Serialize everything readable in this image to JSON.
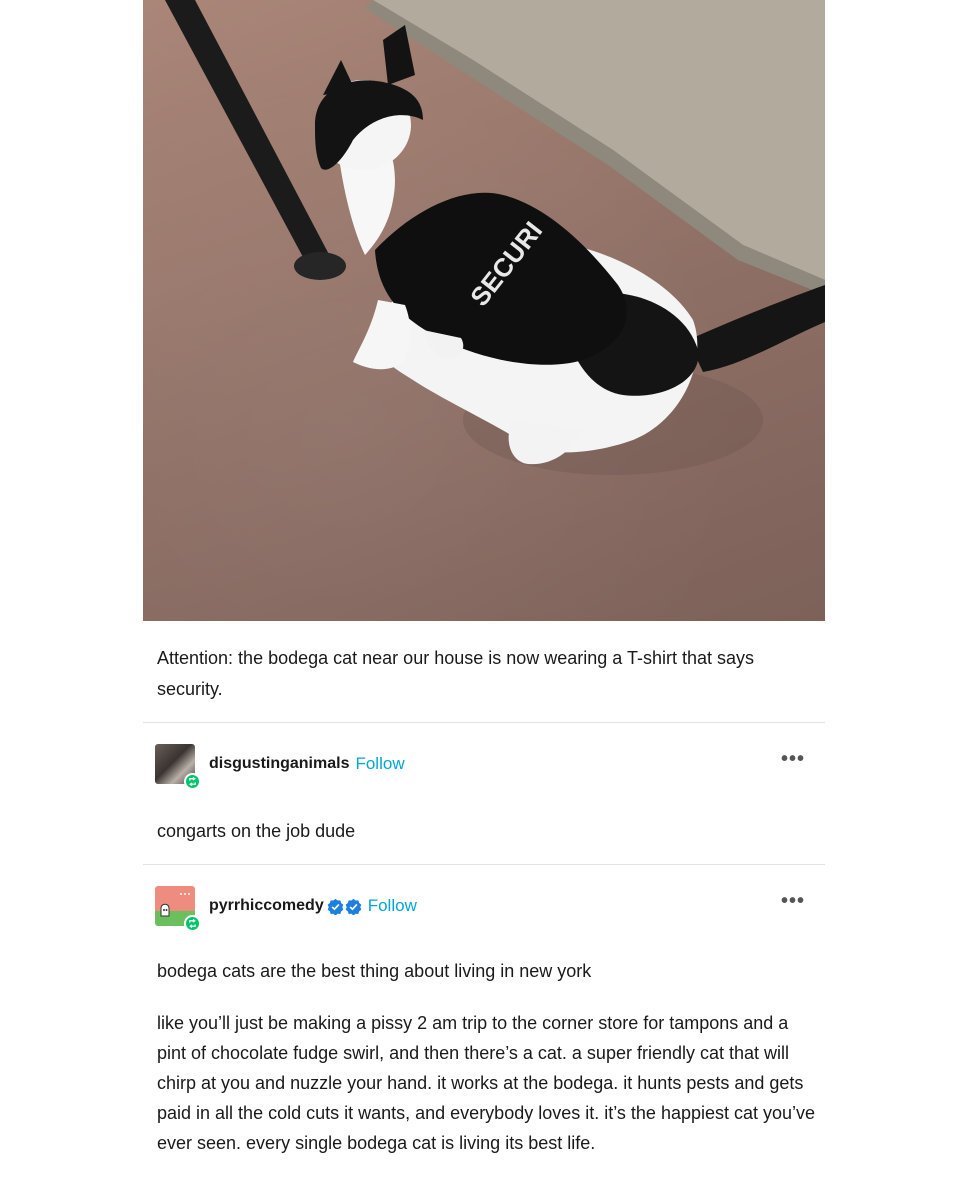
{
  "post": {
    "photo": {
      "shirt_text": "SECURI"
    },
    "caption": "Attention: the bodega cat near our house is now wearing a T-shirt that says security."
  },
  "reblogs": [
    {
      "username": "disgustinganimals",
      "follow_label": "Follow",
      "more_label": "•••",
      "paragraphs": [
        "congarts on the job dude"
      ]
    },
    {
      "username": "pyrrhiccomedy",
      "follow_label": "Follow",
      "more_label": "•••",
      "verified_icons": [
        "verified-badge-icon",
        "verified-badge-icon"
      ],
      "paragraphs": [
        "bodega cats are the best thing about living in new york",
        "like you’ll just be making a pissy 2 am trip to the corner store for tampons and a pint of chocolate fudge swirl, and then there’s a cat. a super friendly cat that will chirp at you and nuzzle your hand. it works at the bodega. it hunts pests and gets paid in all the cold cuts it wants, and everybody loves it. it’s the happiest cat you’ve ever seen. every single bodega cat is living its best life."
      ]
    }
  ],
  "colors": {
    "follow": "#00a7d8",
    "reblog_badge": "#00c46a",
    "verified": "#1d7fe0"
  }
}
